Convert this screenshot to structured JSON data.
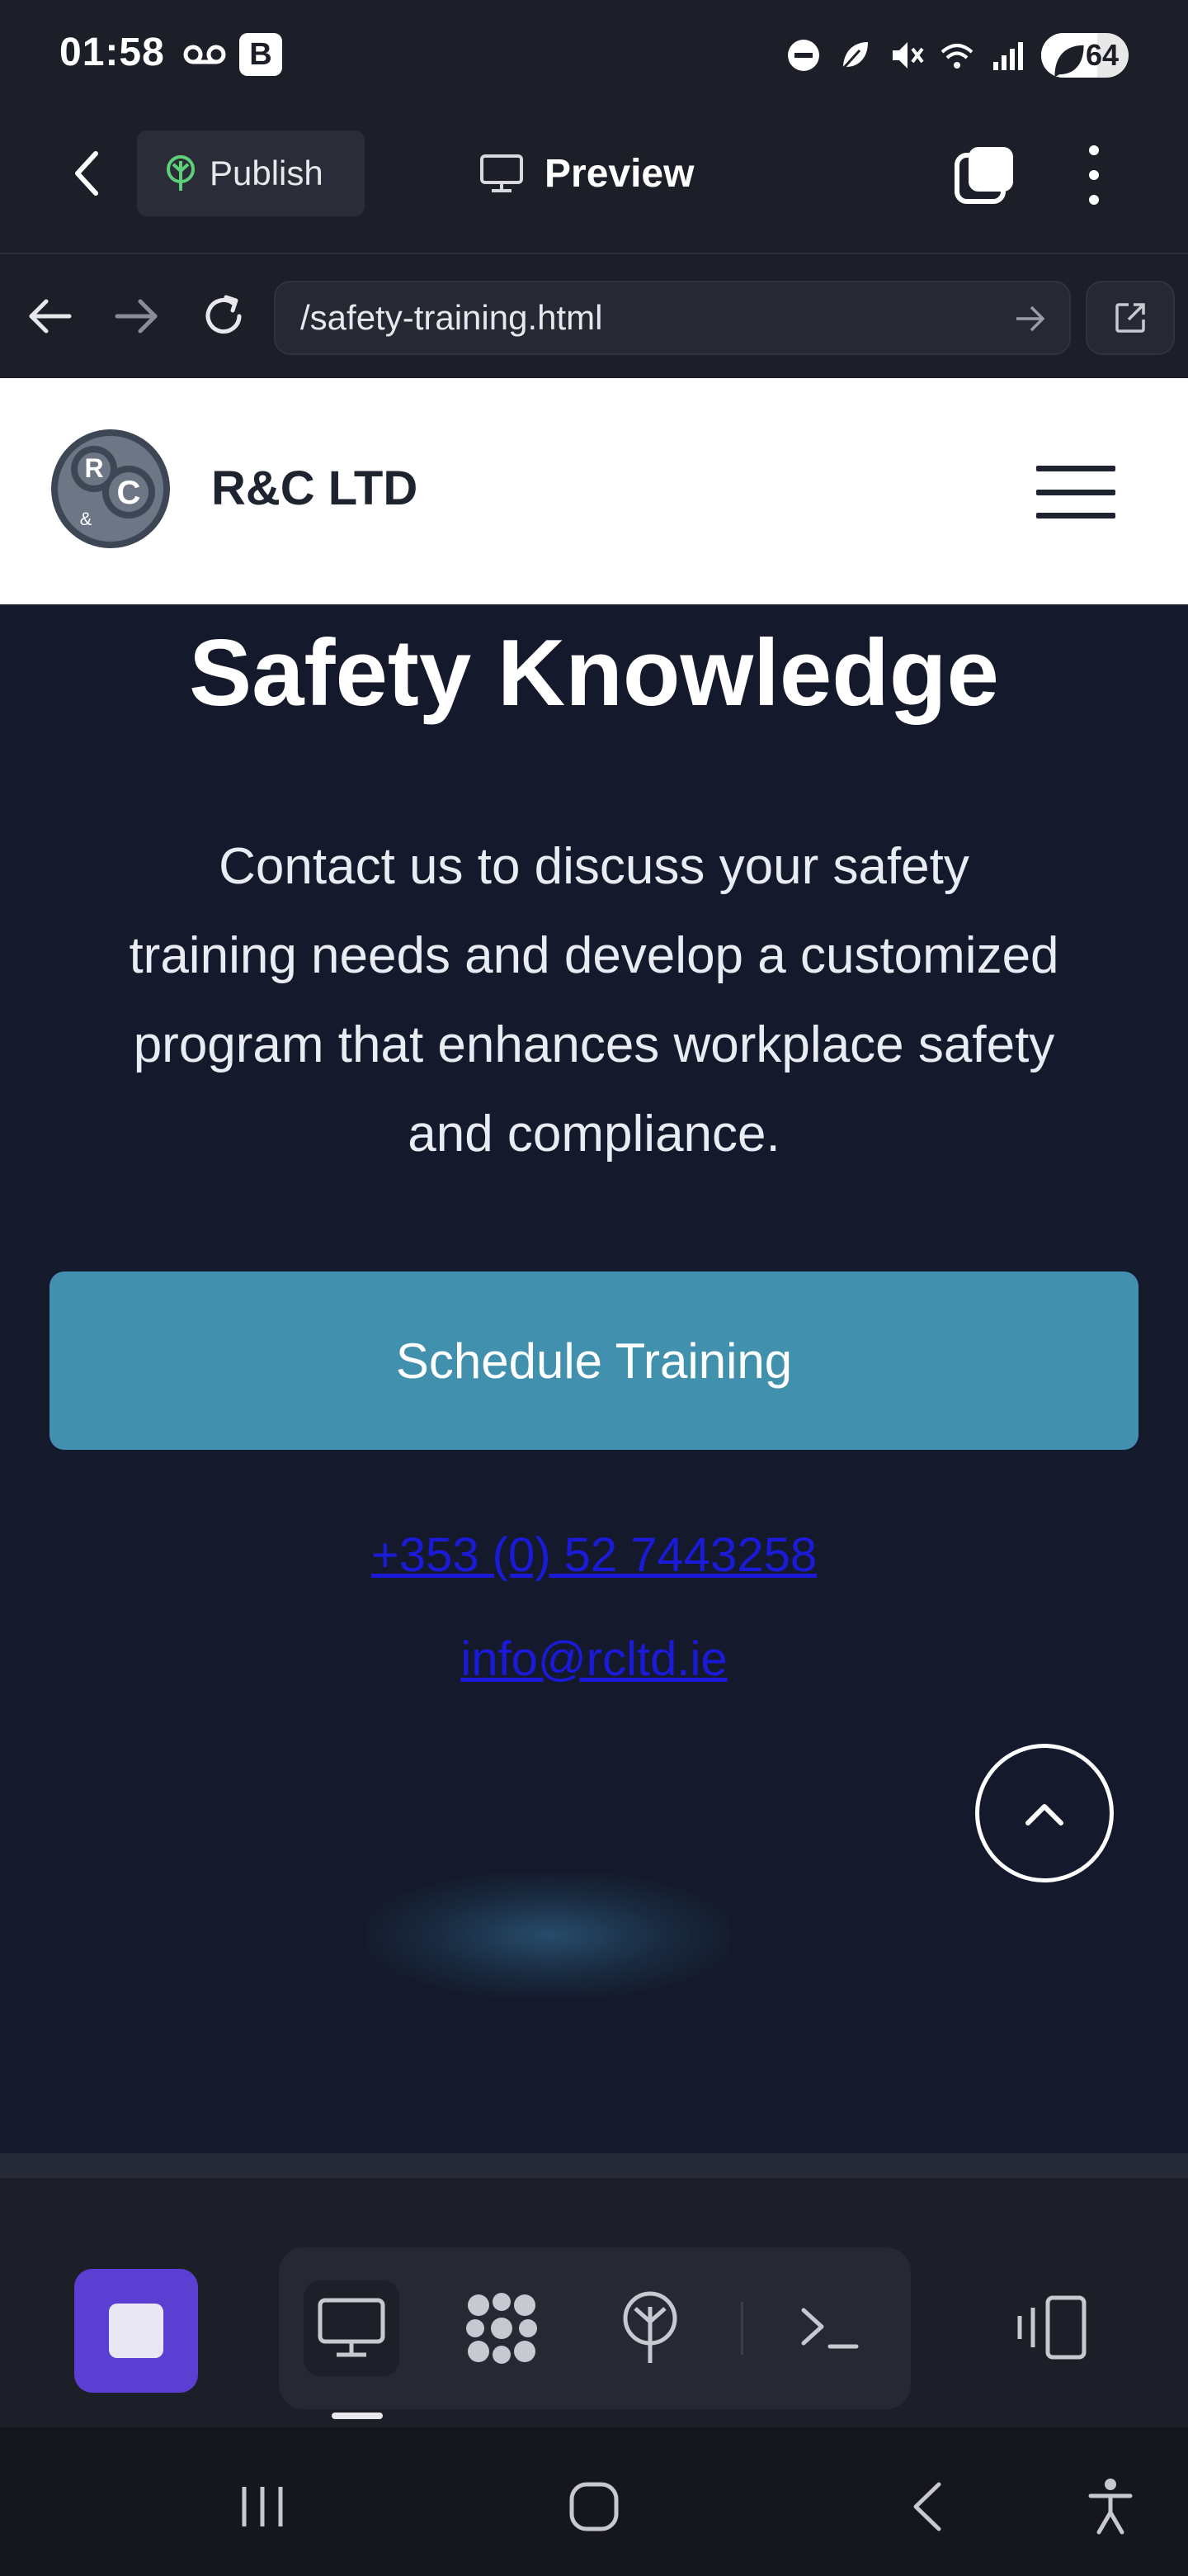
{
  "status_bar": {
    "time": "01:58",
    "b_badge": "B",
    "battery_level": "64",
    "icons": [
      "voicemail-icon",
      "dnd-icon",
      "leaf-icon",
      "mute-icon",
      "wifi-icon",
      "signal-icon",
      "battery-icon"
    ]
  },
  "toolbar": {
    "publish_label": "Publish",
    "preview_label": "Preview",
    "icons": [
      "back-arrow-icon",
      "publish-tree-icon",
      "monitor-icon",
      "tabs-icon",
      "more-vertical-icon"
    ]
  },
  "browser": {
    "url": "/safety-training.html",
    "icons": [
      "nav-back-icon",
      "nav-forward-icon",
      "reload-icon",
      "go-arrow-icon",
      "external-link-icon"
    ]
  },
  "site": {
    "logo_letters": [
      "R",
      "C",
      "&"
    ],
    "name": "R&C LTD",
    "icons": [
      "hamburger-menu-icon"
    ]
  },
  "content": {
    "heading": "Safety Knowledge",
    "description_lines": [
      "Contact us to discuss your safety",
      "training needs and develop a customized",
      "program that enhances workplace safety",
      "and compliance."
    ],
    "cta_label": "Schedule Training",
    "phone": "+353 (0) 52 7443258",
    "email": "info@rcltd.ie",
    "icons": [
      "chevron-up-icon"
    ]
  },
  "dock": {
    "icons": [
      "stop-icon",
      "desktop-icon",
      "grid-blob-icon",
      "deploy-icon",
      "terminal-icon",
      "layout-toggle-icon"
    ]
  },
  "system_nav": {
    "icons": [
      "recents-icon",
      "home-icon",
      "back-icon",
      "accessibility-icon"
    ]
  },
  "colors": {
    "cta": "#4190ae",
    "content_bg": "#141a2b",
    "stop_button": "#5b3fd3",
    "link": "#1a1ad8"
  }
}
